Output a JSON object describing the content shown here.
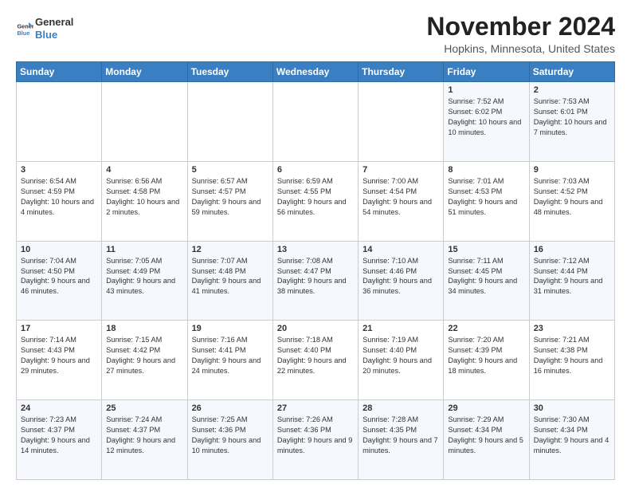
{
  "header": {
    "logo_line1": "General",
    "logo_line2": "Blue",
    "month_title": "November 2024",
    "location": "Hopkins, Minnesota, United States"
  },
  "weekdays": [
    "Sunday",
    "Monday",
    "Tuesday",
    "Wednesday",
    "Thursday",
    "Friday",
    "Saturday"
  ],
  "weeks": [
    [
      {
        "day": "",
        "text": ""
      },
      {
        "day": "",
        "text": ""
      },
      {
        "day": "",
        "text": ""
      },
      {
        "day": "",
        "text": ""
      },
      {
        "day": "",
        "text": ""
      },
      {
        "day": "1",
        "text": "Sunrise: 7:52 AM\nSunset: 6:02 PM\nDaylight: 10 hours and 10 minutes."
      },
      {
        "day": "2",
        "text": "Sunrise: 7:53 AM\nSunset: 6:01 PM\nDaylight: 10 hours and 7 minutes."
      }
    ],
    [
      {
        "day": "3",
        "text": "Sunrise: 6:54 AM\nSunset: 4:59 PM\nDaylight: 10 hours and 4 minutes."
      },
      {
        "day": "4",
        "text": "Sunrise: 6:56 AM\nSunset: 4:58 PM\nDaylight: 10 hours and 2 minutes."
      },
      {
        "day": "5",
        "text": "Sunrise: 6:57 AM\nSunset: 4:57 PM\nDaylight: 9 hours and 59 minutes."
      },
      {
        "day": "6",
        "text": "Sunrise: 6:59 AM\nSunset: 4:55 PM\nDaylight: 9 hours and 56 minutes."
      },
      {
        "day": "7",
        "text": "Sunrise: 7:00 AM\nSunset: 4:54 PM\nDaylight: 9 hours and 54 minutes."
      },
      {
        "day": "8",
        "text": "Sunrise: 7:01 AM\nSunset: 4:53 PM\nDaylight: 9 hours and 51 minutes."
      },
      {
        "day": "9",
        "text": "Sunrise: 7:03 AM\nSunset: 4:52 PM\nDaylight: 9 hours and 48 minutes."
      }
    ],
    [
      {
        "day": "10",
        "text": "Sunrise: 7:04 AM\nSunset: 4:50 PM\nDaylight: 9 hours and 46 minutes."
      },
      {
        "day": "11",
        "text": "Sunrise: 7:05 AM\nSunset: 4:49 PM\nDaylight: 9 hours and 43 minutes."
      },
      {
        "day": "12",
        "text": "Sunrise: 7:07 AM\nSunset: 4:48 PM\nDaylight: 9 hours and 41 minutes."
      },
      {
        "day": "13",
        "text": "Sunrise: 7:08 AM\nSunset: 4:47 PM\nDaylight: 9 hours and 38 minutes."
      },
      {
        "day": "14",
        "text": "Sunrise: 7:10 AM\nSunset: 4:46 PM\nDaylight: 9 hours and 36 minutes."
      },
      {
        "day": "15",
        "text": "Sunrise: 7:11 AM\nSunset: 4:45 PM\nDaylight: 9 hours and 34 minutes."
      },
      {
        "day": "16",
        "text": "Sunrise: 7:12 AM\nSunset: 4:44 PM\nDaylight: 9 hours and 31 minutes."
      }
    ],
    [
      {
        "day": "17",
        "text": "Sunrise: 7:14 AM\nSunset: 4:43 PM\nDaylight: 9 hours and 29 minutes."
      },
      {
        "day": "18",
        "text": "Sunrise: 7:15 AM\nSunset: 4:42 PM\nDaylight: 9 hours and 27 minutes."
      },
      {
        "day": "19",
        "text": "Sunrise: 7:16 AM\nSunset: 4:41 PM\nDaylight: 9 hours and 24 minutes."
      },
      {
        "day": "20",
        "text": "Sunrise: 7:18 AM\nSunset: 4:40 PM\nDaylight: 9 hours and 22 minutes."
      },
      {
        "day": "21",
        "text": "Sunrise: 7:19 AM\nSunset: 4:40 PM\nDaylight: 9 hours and 20 minutes."
      },
      {
        "day": "22",
        "text": "Sunrise: 7:20 AM\nSunset: 4:39 PM\nDaylight: 9 hours and 18 minutes."
      },
      {
        "day": "23",
        "text": "Sunrise: 7:21 AM\nSunset: 4:38 PM\nDaylight: 9 hours and 16 minutes."
      }
    ],
    [
      {
        "day": "24",
        "text": "Sunrise: 7:23 AM\nSunset: 4:37 PM\nDaylight: 9 hours and 14 minutes."
      },
      {
        "day": "25",
        "text": "Sunrise: 7:24 AM\nSunset: 4:37 PM\nDaylight: 9 hours and 12 minutes."
      },
      {
        "day": "26",
        "text": "Sunrise: 7:25 AM\nSunset: 4:36 PM\nDaylight: 9 hours and 10 minutes."
      },
      {
        "day": "27",
        "text": "Sunrise: 7:26 AM\nSunset: 4:36 PM\nDaylight: 9 hours and 9 minutes."
      },
      {
        "day": "28",
        "text": "Sunrise: 7:28 AM\nSunset: 4:35 PM\nDaylight: 9 hours and 7 minutes."
      },
      {
        "day": "29",
        "text": "Sunrise: 7:29 AM\nSunset: 4:34 PM\nDaylight: 9 hours and 5 minutes."
      },
      {
        "day": "30",
        "text": "Sunrise: 7:30 AM\nSunset: 4:34 PM\nDaylight: 9 hours and 4 minutes."
      }
    ]
  ]
}
